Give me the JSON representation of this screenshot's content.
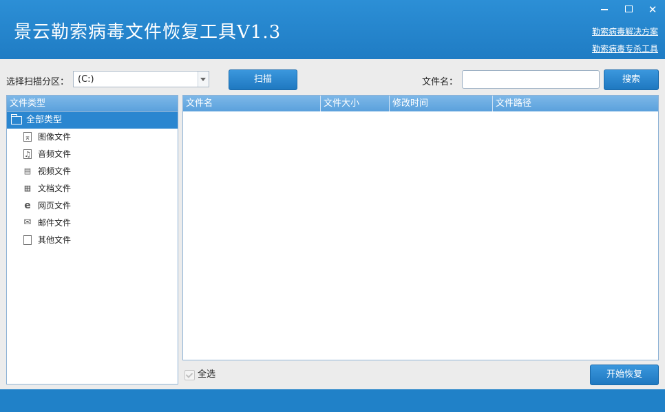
{
  "app": {
    "title": "景云勒索病毒文件恢复工具V1.3",
    "links": [
      "勒索病毒解决方案",
      "勒索病毒专杀工具"
    ]
  },
  "window_controls": {
    "minimize_icon": "minimize-icon",
    "maximize_icon": "maximize-icon",
    "close_icon": "close-icon"
  },
  "toolbar": {
    "partition_label": "选择扫描分区：",
    "partition_value": "(C:)",
    "scan_label": "扫描",
    "filename_label": "文件名：",
    "filename_value": "",
    "search_label": "搜索"
  },
  "tree": {
    "header": "文件类型",
    "all_label": "全部类型",
    "items": [
      {
        "label": "图像文件",
        "icon": "image-file-icon"
      },
      {
        "label": "音频文件",
        "icon": "audio-file-icon"
      },
      {
        "label": "视频文件",
        "icon": "video-file-icon"
      },
      {
        "label": "文档文件",
        "icon": "document-file-icon"
      },
      {
        "label": "网页文件",
        "icon": "web-file-icon"
      },
      {
        "label": "邮件文件",
        "icon": "mail-file-icon"
      },
      {
        "label": "其他文件",
        "icon": "other-file-icon"
      }
    ]
  },
  "table": {
    "columns": [
      "文件名",
      "文件大小",
      "修改时间",
      "文件路径"
    ],
    "rows": []
  },
  "bottom": {
    "select_all_label": "全选",
    "recover_label": "开始恢复"
  },
  "colors": {
    "header_blue": "#1f7cc4",
    "selected_blue": "#2a86d0",
    "column_header_blue": "#5aa0dc"
  }
}
